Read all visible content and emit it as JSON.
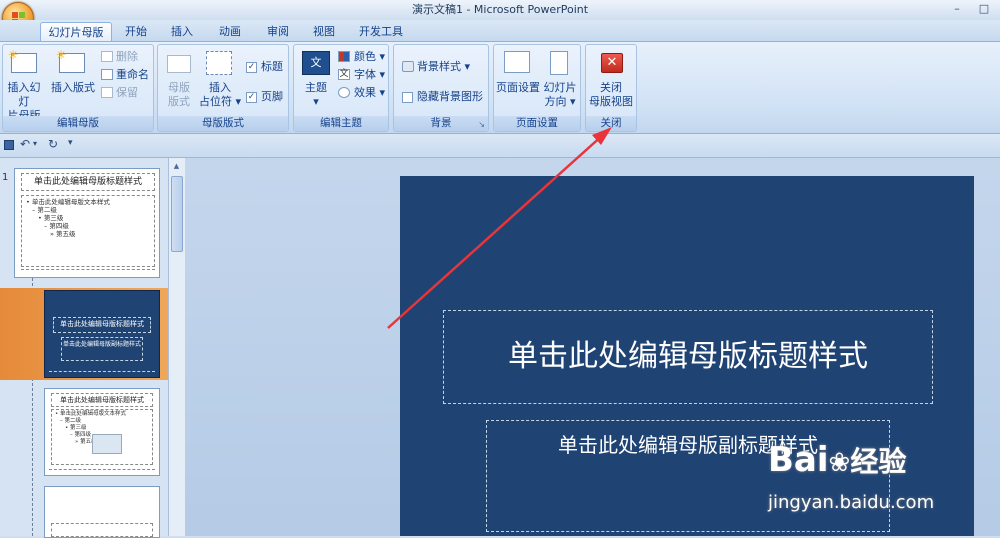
{
  "window": {
    "title": "演示文稿1 - Microsoft PowerPoint",
    "controls": [
      "–",
      "□",
      "✕"
    ]
  },
  "tabs": [
    {
      "label": "幻灯片母版",
      "active": true
    },
    {
      "label": "开始"
    },
    {
      "label": "插入"
    },
    {
      "label": "动画"
    },
    {
      "label": "审阅"
    },
    {
      "label": "视图"
    },
    {
      "label": "开发工具"
    }
  ],
  "ribbon": {
    "edit_master": {
      "label": "编辑母版",
      "insert_slide_master_l1": "插入幻灯",
      "insert_slide_master_l2": "片母版",
      "insert_layout": "插入版式",
      "delete": "删除",
      "rename": "重命名",
      "preserve": "保留"
    },
    "master_layout": {
      "label": "母版版式",
      "master_layout_l1": "母版",
      "master_layout_l2": "版式",
      "insert_placeholder_l1": "插入",
      "insert_placeholder_l2": "占位符",
      "title_chk": "标题",
      "footer_chk": "页脚"
    },
    "edit_theme": {
      "label": "编辑主题",
      "themes": "主题",
      "colors": "颜色",
      "fonts": "字体",
      "effects": "效果"
    },
    "background": {
      "label": "背景",
      "bg_styles": "背景样式",
      "hide_bg": "隐藏背景图形"
    },
    "page_setup": {
      "label": "页面设置",
      "page_setup_btn": "页面设置",
      "orientation_l1": "幻灯片",
      "orientation_l2": "方向"
    },
    "close": {
      "label": "关闭",
      "close_l1": "关闭",
      "close_l2": "母版视图"
    }
  },
  "qat": {
    "dropdown": "▾"
  },
  "thumbnails": {
    "slide_number": "1",
    "t1_title": "单击此处编辑母版标题样式",
    "t1_body": "• 单击此处编辑母版文本样式",
    "t1_l2": "– 第二级",
    "t1_l3": "• 第三级",
    "t1_l4": "– 第四级",
    "t1_l5": "» 第五级",
    "t2_title": "单击此处编辑母版标题样式",
    "t2_sub": "单击此处编辑母版副标题样式",
    "t3_title": "单击此处编辑母版标题样式",
    "t3_body": "• 单击此处编辑母版文本样式",
    "t3_l2": "– 第二级",
    "t3_l3": "• 第三级",
    "t3_l4": "– 第四级",
    "t3_l5": "» 第五级"
  },
  "slide": {
    "title": "单击此处编辑母版标题样式",
    "subtitle": "单击此处编辑母版副标题样式",
    "background": "#1f4373"
  },
  "watermark": {
    "brand": "Bai",
    "brand2": "经验",
    "url": "jingyan.baidu.com"
  },
  "colors": {
    "annotation_arrow": "#e8343a",
    "close_icon": "#d83a2e"
  }
}
